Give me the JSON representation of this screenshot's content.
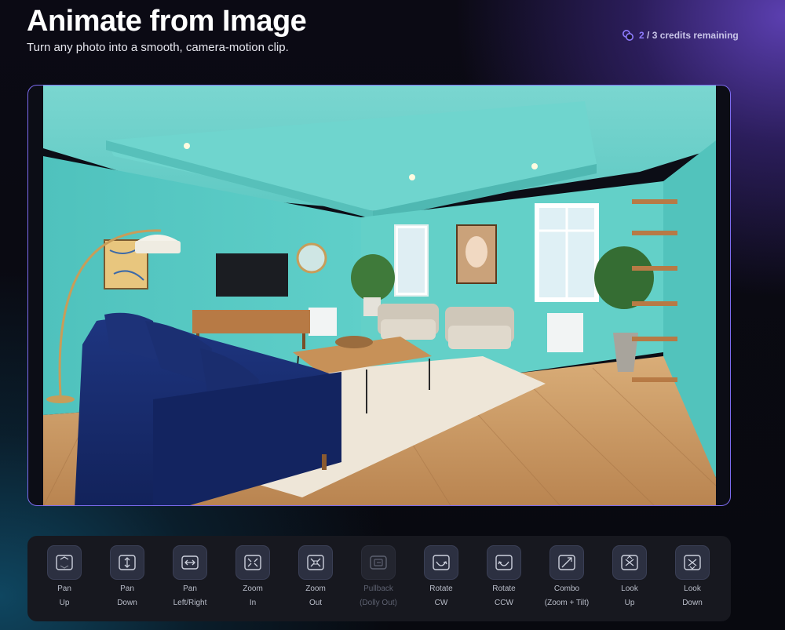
{
  "header": {
    "title": "Animate from Image",
    "subtitle": "Turn any photo into a smooth, camera-motion clip."
  },
  "credits": {
    "icon": "coins-icon",
    "used": "2",
    "rest": " / 3 credits remaining"
  },
  "preview": {
    "alt": "Living room with turquoise walls, navy velvet sofa, coffee table and wooden floor"
  },
  "motions": [
    {
      "line1": "Pan",
      "line2": "Up",
      "icon": "pan-up-icon",
      "enabled": true
    },
    {
      "line1": "Pan",
      "line2": "Down",
      "icon": "pan-down-icon",
      "enabled": true
    },
    {
      "line1": "Pan",
      "line2": "Left/Right",
      "icon": "pan-left-right-icon",
      "enabled": true
    },
    {
      "line1": "Zoom",
      "line2": "In",
      "icon": "zoom-in-icon",
      "enabled": true
    },
    {
      "line1": "Zoom",
      "line2": "Out",
      "icon": "zoom-out-icon",
      "enabled": true
    },
    {
      "line1": "Pullback",
      "line2": "(Dolly Out)",
      "icon": "pullback-icon",
      "enabled": false
    },
    {
      "line1": "Rotate",
      "line2": "CW",
      "icon": "rotate-cw-icon",
      "enabled": true
    },
    {
      "line1": "Rotate",
      "line2": "CCW",
      "icon": "rotate-ccw-icon",
      "enabled": true
    },
    {
      "line1": "Combo",
      "line2": "(Zoom + Tilt)",
      "icon": "combo-icon",
      "enabled": true
    },
    {
      "line1": "Look",
      "line2": "Up",
      "icon": "look-up-icon",
      "enabled": true
    },
    {
      "line1": "Look",
      "line2": "Down",
      "icon": "look-down-icon",
      "enabled": true
    }
  ],
  "colors": {
    "accent": "#8f7cff",
    "canvas_border": "#7d6cf0",
    "toolbar_bg": "#17181f",
    "button_bg": "#2c3041"
  }
}
